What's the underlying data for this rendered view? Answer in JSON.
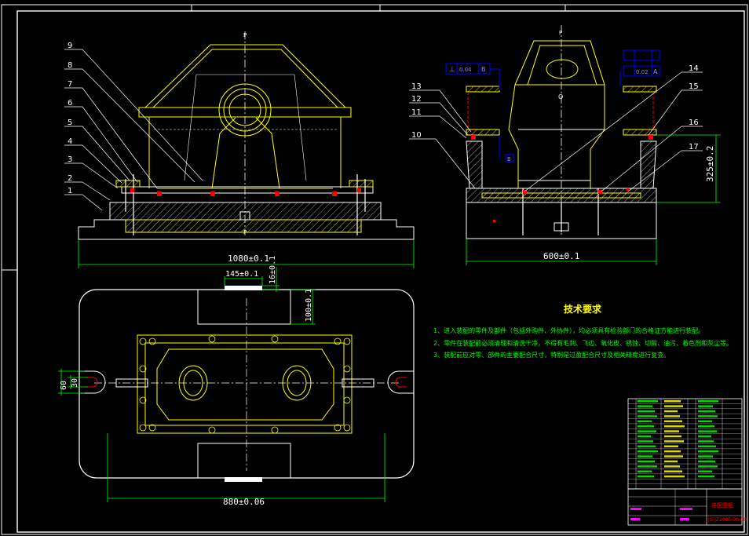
{
  "drawing": {
    "front_view_dimensions": {
      "overall_width": "1080±0.1"
    },
    "side_view_dimensions": {
      "overall_width": "600±0.1",
      "height": "325±0.2"
    },
    "plan_view_dimensions": {
      "width": "880±0.06",
      "top_block": "145±0.1",
      "top_offset": "16±0.1",
      "depth": "100±0.1",
      "slot_outer": "60",
      "slot_inner": "30"
    },
    "front_part_numbers": [
      "9",
      "8",
      "7",
      "6",
      "5",
      "4",
      "3",
      "2",
      "1"
    ],
    "side_part_numbers_left": [
      "13",
      "12",
      "11",
      "10"
    ],
    "side_part_numbers_right": [
      "14",
      "15",
      "16",
      "17"
    ],
    "section_marks": [
      "P",
      "P",
      "O"
    ],
    "gdt": {
      "left_symbol": "⊥",
      "left_tol": "0.04",
      "left_datum": "B",
      "right_tol": "0.02",
      "right_datum": "A",
      "datum_b": "B"
    },
    "technical_requirements": {
      "title": "技术要求",
      "items": [
        "1、进入装配的零件及部件（包括外购件、外协件），均必须具有检验部门的合格证方能进行装配。",
        "2、零件在装配前必须清理和清洗干净，不得有毛刺、飞边、氧化皮、锈蚀、切屑、油污、着色剂和灰尘等。",
        "3、装配前应对零、部件的主要配合尺寸，特别是过盈配合尺寸及相关精度进行复查。"
      ]
    },
    "title_block": {
      "drawing_no": "JS-JZ2005-00-00",
      "name": "装配图纸"
    }
  },
  "colors": {
    "outline": "#ffffff",
    "part": "#ffff00",
    "dimension": "#00ff00",
    "hatch": "#ffff00",
    "accent": "#ff0000",
    "gdt": "#0000ff",
    "note": "#00ff00"
  }
}
